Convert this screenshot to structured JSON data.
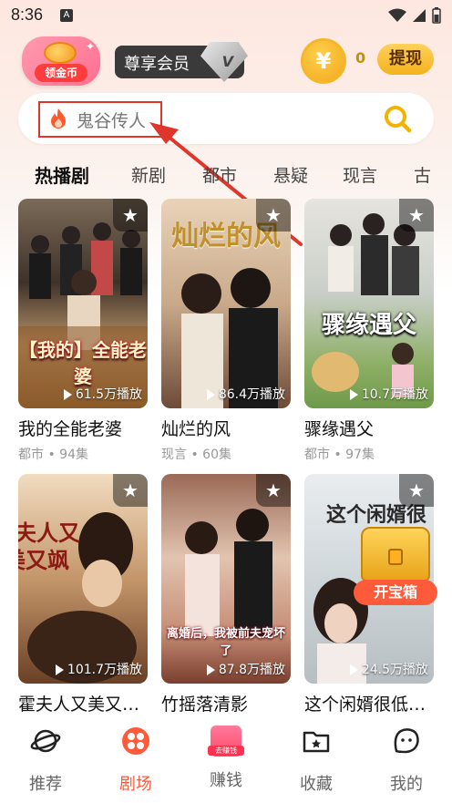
{
  "status_bar": {
    "time": "8:36",
    "notification_letter": "A"
  },
  "header": {
    "coin_badge_label": "领金币",
    "vip_label": "尊享会员",
    "vip_mark": "V",
    "coin_symbol": "¥",
    "coin_count": "0",
    "withdraw_label": "提现"
  },
  "search": {
    "query": "鬼谷传人"
  },
  "tabs": [
    {
      "label": "热播剧",
      "active": true
    },
    {
      "label": "新剧"
    },
    {
      "label": "都市"
    },
    {
      "label": "悬疑"
    },
    {
      "label": "现言"
    },
    {
      "label": "古"
    }
  ],
  "dramas": [
    {
      "title": "我的全能老婆",
      "meta": "都市 • 94集",
      "plays": "61.5万播放",
      "poster_text": "【我的】全能老婆"
    },
    {
      "title": "灿烂的风",
      "meta": "现言 • 60集",
      "plays": "86.4万播放",
      "poster_text": "灿烂的风"
    },
    {
      "title": "骤缘遇父",
      "meta": "都市 • 97集",
      "plays": "10.7万播放",
      "poster_text": "骤缘遇父"
    },
    {
      "title": "霍夫人又美又…",
      "meta": "",
      "plays": "101.7万播放",
      "poster_text": "霍夫人又美又飒"
    },
    {
      "title": "竹摇落清影",
      "meta": "",
      "plays": "87.8万播放",
      "poster_text": "离婚后，我被前夫宠坏了"
    },
    {
      "title": "这个闲婿很低…",
      "meta": "",
      "plays": "24.5万播放",
      "poster_text": "这个闲婿很低调"
    }
  ],
  "treasure": {
    "label": "开宝箱"
  },
  "bottom_nav": [
    {
      "label": "推荐",
      "icon": "planet-icon"
    },
    {
      "label": "剧场",
      "icon": "theater-icon",
      "active": true
    },
    {
      "label": "赚钱",
      "icon": "earn-icon",
      "icon_text": "去赚钱"
    },
    {
      "label": "收藏",
      "icon": "folder-star-icon"
    },
    {
      "label": "我的",
      "icon": "profile-icon"
    }
  ],
  "colors": {
    "accent": "#ff5a3a",
    "gold": "#f3b21e",
    "highlight_box": "#e0352b"
  }
}
